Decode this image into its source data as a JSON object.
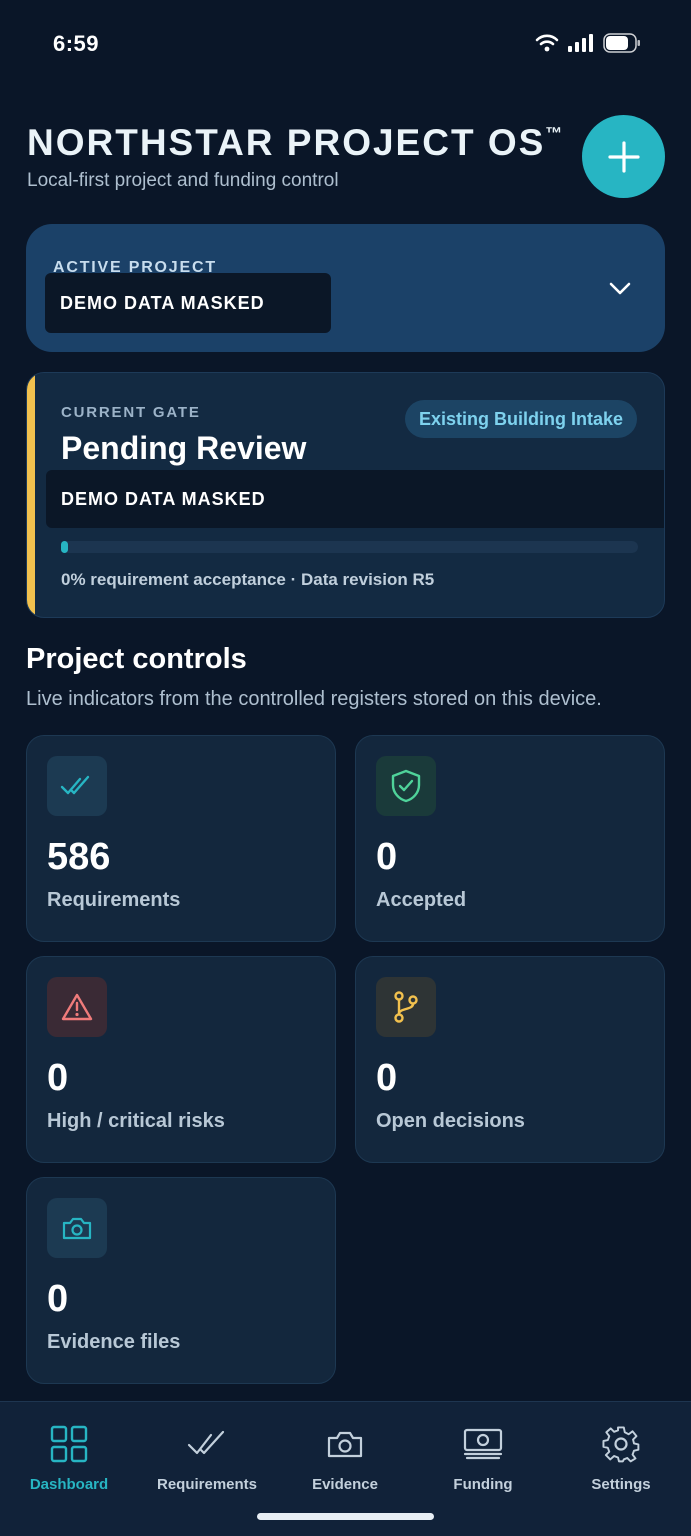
{
  "status_bar": {
    "time": "6:59"
  },
  "header": {
    "title": "NORTHSTAR PROJECT OS",
    "trademark": "™",
    "subtitle": "Local-first project and funding control"
  },
  "active_project": {
    "label": "ACTIVE PROJECT",
    "value": "DEMO DATA MASKED"
  },
  "current_gate": {
    "label": "CURRENT GATE",
    "title": "Pending Review",
    "badge": "Existing Building Intake",
    "masked_line": "DEMO DATA MASKED",
    "progress_percent": 0,
    "meta": "0% requirement acceptance · Data revision R5"
  },
  "controls": {
    "title": "Project controls",
    "description": "Live indicators from the controlled registers stored on this device.",
    "stats": [
      {
        "value": "586",
        "label": "Requirements",
        "icon": "double-check-icon"
      },
      {
        "value": "0",
        "label": "Accepted",
        "icon": "shield-check-icon"
      },
      {
        "value": "0",
        "label": "High / critical risks",
        "icon": "warning-icon"
      },
      {
        "value": "0",
        "label": "Open decisions",
        "icon": "branch-icon"
      },
      {
        "value": "0",
        "label": "Evidence files",
        "icon": "camera-icon"
      }
    ]
  },
  "nav": [
    {
      "label": "Dashboard",
      "icon": "grid-icon",
      "active": true
    },
    {
      "label": "Requirements",
      "icon": "double-check-icon",
      "active": false
    },
    {
      "label": "Evidence",
      "icon": "camera-icon",
      "active": false
    },
    {
      "label": "Funding",
      "icon": "money-icon",
      "active": false
    },
    {
      "label": "Settings",
      "icon": "gear-icon",
      "active": false
    }
  ],
  "colors": {
    "background": "#0a1628",
    "accent": "#27b5c3",
    "gate_accent": "#f2c14e",
    "project_card": "#1b4168"
  }
}
